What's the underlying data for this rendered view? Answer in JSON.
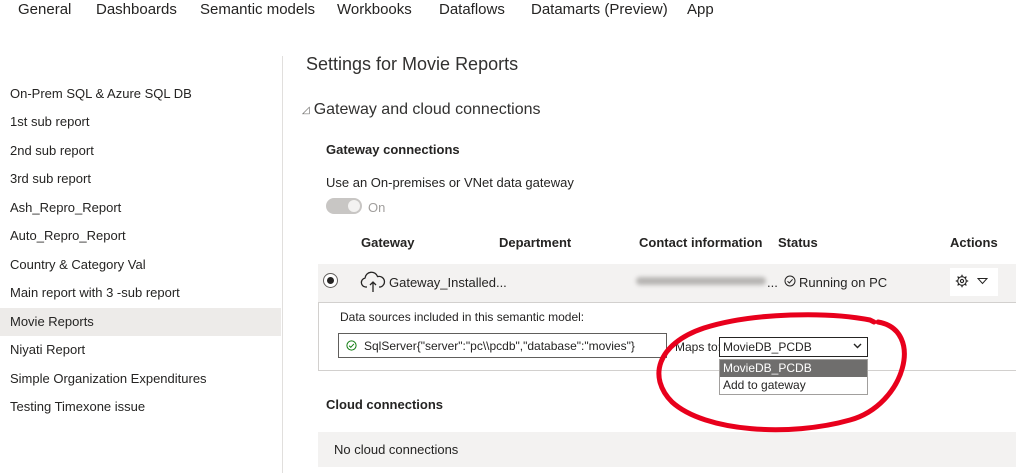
{
  "tabs": [
    "General",
    "Dashboards",
    "Semantic models",
    "Workbooks",
    "Dataflows",
    "Datamarts (Preview)",
    "App"
  ],
  "sidebar": {
    "items": [
      {
        "label": "On-Prem SQL & Azure SQL DB"
      },
      {
        "label": "1st sub report"
      },
      {
        "label": "2nd sub report"
      },
      {
        "label": "3rd sub report"
      },
      {
        "label": "Ash_Repro_Report"
      },
      {
        "label": "Auto_Repro_Report"
      },
      {
        "label": "Country & Category Val"
      },
      {
        "label": "Main report with 3 -sub report"
      },
      {
        "label": "Movie Reports"
      },
      {
        "label": "Niyati Report"
      },
      {
        "label": "Simple Organization Expenditures"
      },
      {
        "label": "Testing Timexone issue"
      }
    ],
    "active_index": 8
  },
  "main": {
    "title": "Settings for Movie Reports",
    "section": "Gateway and cloud connections",
    "gateway_connections": {
      "title": "Gateway connections",
      "toggle_label": "Use an On-premises or VNet data gateway",
      "toggle_state": "On",
      "columns": [
        "Gateway",
        "Department",
        "Contact information",
        "Status",
        "Actions"
      ],
      "row": {
        "gateway": "Gateway_Installed...",
        "contact_suffix": "...",
        "status": "Running on PC"
      },
      "data_sources": {
        "label": "Data sources included in this semantic model:",
        "source": "SqlServer{\"server\":\"pc\\\\pcdb\",\"database\":\"movies\"}",
        "maps_to_label": "Maps to:",
        "selected": "MovieDB_PCDB",
        "options": [
          "MovieDB_PCDB",
          "Add to gateway"
        ]
      }
    },
    "cloud_connections": {
      "title": "Cloud connections",
      "empty_text": "No cloud connections"
    }
  },
  "colors": {
    "annotation_red": "#e8001c",
    "active_bg": "#edebe9",
    "row_bg": "#f3f2f1",
    "status_ok_green": "#107c10"
  }
}
